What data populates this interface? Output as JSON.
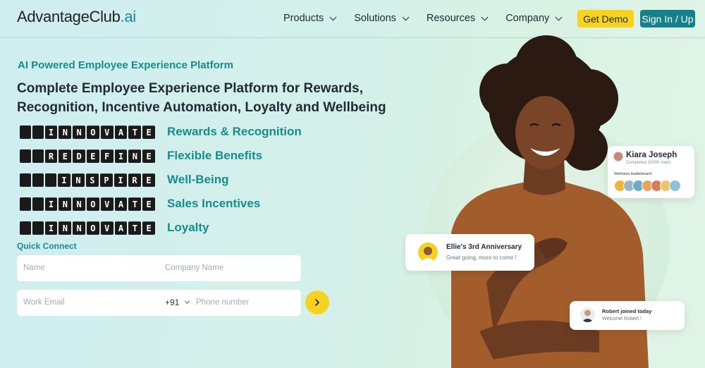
{
  "brand": {
    "name_main": "AdvantageClub",
    "name_suffix": "ai"
  },
  "nav": {
    "items": [
      {
        "label": "Products"
      },
      {
        "label": "Solutions"
      },
      {
        "label": "Resources"
      },
      {
        "label": "Company"
      }
    ],
    "demo_label": "Get Demo",
    "sign_label": "Sign In / Up"
  },
  "hero": {
    "tagline": "AI Powered Employee Experience Platform",
    "headline": "Complete Employee Experience Platform for Rewards, Recognition, Incentive Automation, Loyalty and Wellbeing",
    "rows": [
      {
        "board": "INNOVATE",
        "label": "Rewards & Recognition"
      },
      {
        "board": "REDEFINE",
        "label": "Flexible Benefits"
      },
      {
        "board": "INSPIRE",
        "label": "Well-Being"
      },
      {
        "board": "INNOVATE",
        "label": "Sales Incentives"
      },
      {
        "board": "INNOVATE",
        "label": "Loyalty"
      }
    ]
  },
  "form": {
    "title": "Quick Connect",
    "name_placeholder": "Name",
    "company_placeholder": "Company Name",
    "email_placeholder": "Work Email",
    "country_code": "+91",
    "phone_placeholder": "Phone number"
  },
  "cards": {
    "kiara": {
      "name": "Kiara Joseph",
      "sub": "Completed 10000 steps",
      "leaderboard": "Wellness leaderboard"
    },
    "ellie": {
      "title": "Ellie's 3rd Anniversary",
      "sub": "Great going, more to come !"
    },
    "robert": {
      "title": "Robert joined today",
      "sub": "Welcome Robert !"
    }
  },
  "colors": {
    "accent": "#178c8c",
    "yellow": "#f7d320",
    "teal_button": "#148089"
  }
}
